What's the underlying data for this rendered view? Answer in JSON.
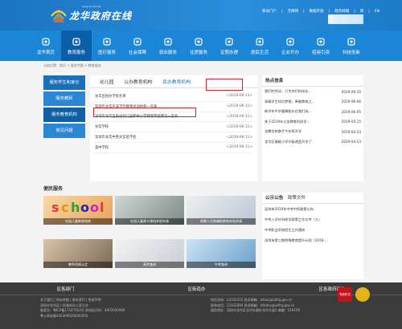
{
  "header": {
    "logo_title": "龙华政府在线",
    "logo_sub": "Longhua Online",
    "toplinks": [
      "移动门户",
      "无障碍",
      "数据开放",
      "政务邮箱",
      "简",
      "EN"
    ]
  },
  "nav": [
    {
      "label": "龙华首页",
      "icon": "home-icon"
    },
    {
      "label": "教育服务",
      "icon": "graduation-cap-icon"
    },
    {
      "label": "医疗服务",
      "icon": "medical-cross-icon"
    },
    {
      "label": "社会保障",
      "icon": "shield-icon"
    },
    {
      "label": "就业服务",
      "icon": "briefcase-icon"
    },
    {
      "label": "住房服务",
      "icon": "house-icon"
    },
    {
      "label": "证照办理",
      "icon": "id-card-icon"
    },
    {
      "label": "居民生活",
      "icon": "people-icon"
    },
    {
      "label": "企业开办",
      "icon": "building-icon"
    },
    {
      "label": "招商引资",
      "icon": "handshake-icon"
    },
    {
      "label": "科技创新",
      "icon": "atom-icon"
    }
  ],
  "breadcrumb": "当前位置：首页 > 服务专题 > 教育服务",
  "sidebar": {
    "header": "服务学生和家长",
    "items": [
      "服务教师",
      "服务教育机构",
      "常见问题"
    ]
  },
  "tabs": [
    "幼儿园",
    "公办教育机构",
    "民办教育机构"
  ],
  "list": [
    {
      "title": "龙华区民办学校名单",
      "date": "<2019-06-13>"
    },
    {
      "title": "深圳市龙华区非学历教育培训机构一览表",
      "date": "<2019-06-11>"
    },
    {
      "title": "深圳市龙华区民办幼儿园和中小学教育审批情况一览表",
      "date": "<2019-06-11>"
    },
    {
      "title": "龙华学校",
      "date": "<2019-06-11>"
    },
    {
      "title": "深圳市龙华中英文实验学校",
      "date": "<2019-06-11>"
    },
    {
      "title": "美中学校",
      "date": "<2019-06-11>"
    }
  ],
  "hot": {
    "title": "热点信息",
    "items": [
      {
        "title": "我们的劳动，只为你们的成长...",
        "date": "2019-06-10"
      },
      {
        "title": "承载学生知识梦想，奉献教育之...",
        "date": "2019-06-06"
      },
      {
        "title": "新学年中学健康能长在我们成...",
        "date": "2019-06-05"
      },
      {
        "title": "关于2019年义务教育阶段学...",
        "date": "2019-05-15"
      },
      {
        "title": "龙腾学校携手今年将开学",
        "date": "2019-04-24"
      },
      {
        "title": "龙华区服能小学升级改造开学了",
        "date": "2019-04-23"
      }
    ]
  },
  "bianmin": {
    "title": "便民服务",
    "tiles": [
      "在园儿童教育指南",
      "在园儿童建卡建档补贴申请",
      "保教人员和辅助教育补贴申请",
      "教师资格认定",
      "高考查询",
      "中考查询"
    ]
  },
  "notice": {
    "tabs": [
      "公示公告",
      "政策文件"
    ],
    "items": [
      "深圳市2019年中考中招政策公布",
      "中考入学外科转学政策工作文件（九）",
      "中考职业学校招生工作通知",
      "深圳市第二期特殊教育提升计划（2018-..."
    ]
  },
  "footer": {
    "tabs": [
      "区各部门",
      "区街道办",
      "区各政府网站"
    ],
    "lines_left": [
      "关于我们 | 网站地图 | 联系我们 | 免责声明",
      "深圳市龙华区人民政府办公室主办",
      "备案号：粤ICP备17347563号 网站标识码：4403020006",
      "粤公网安备44030902002630号"
    ],
    "lines_right": [
      "电话咨询：23332222 投诉邮箱：lzhwz@szlhq.gov.cn",
      "联系电话：23332894 投诉邮箱：lzhldxx@szlhq.gov.cn",
      "服务地址：深圳市龙华区龙华办事处龙华大道3 邮编：518109"
    ],
    "badge_text": "党政机关"
  }
}
